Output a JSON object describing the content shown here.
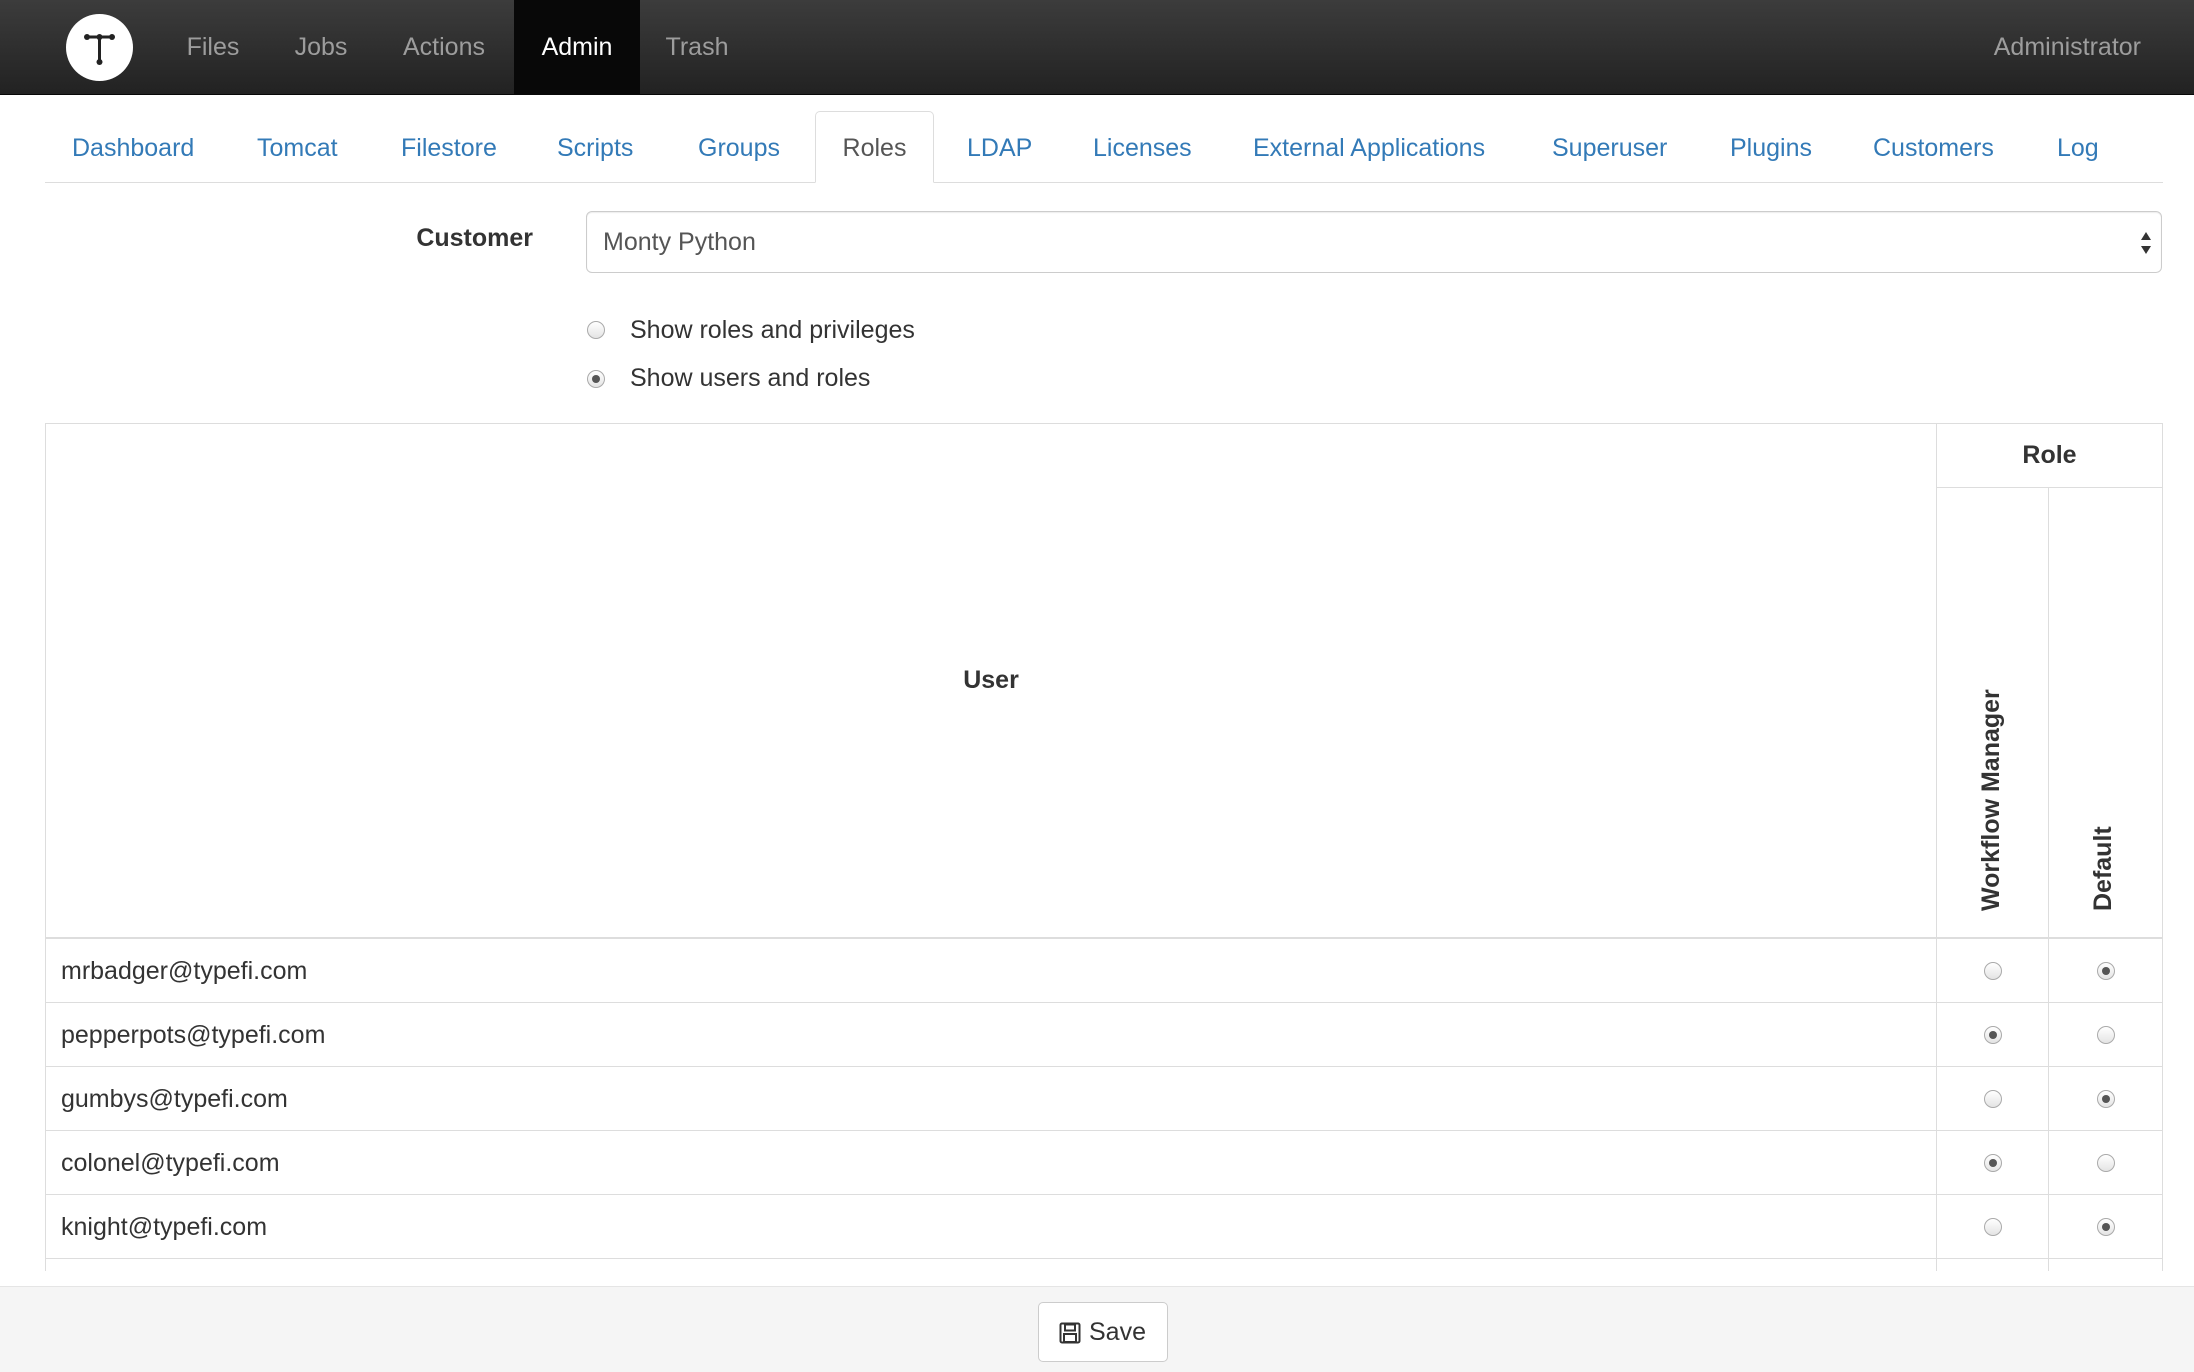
{
  "navbar": {
    "logo_icon": "typefi-t-logo-icon",
    "items": [
      {
        "label": "Files"
      },
      {
        "label": "Jobs"
      },
      {
        "label": "Actions"
      },
      {
        "label": "Admin",
        "active": true
      },
      {
        "label": "Trash"
      }
    ],
    "user": "Administrator"
  },
  "admin_tabs": [
    {
      "label": "Dashboard"
    },
    {
      "label": "Tomcat"
    },
    {
      "label": "Filestore"
    },
    {
      "label": "Scripts"
    },
    {
      "label": "Groups"
    },
    {
      "label": "Roles",
      "active": true
    },
    {
      "label": "LDAP"
    },
    {
      "label": "Licenses"
    },
    {
      "label": "External Applications"
    },
    {
      "label": "Superuser"
    },
    {
      "label": "Plugins"
    },
    {
      "label": "Customers"
    },
    {
      "label": "Log"
    }
  ],
  "customer": {
    "label": "Customer",
    "selected": "Monty Python"
  },
  "view_options": [
    {
      "label": "Show roles and privileges",
      "checked": false
    },
    {
      "label": "Show users and roles",
      "checked": true
    }
  ],
  "table": {
    "user_header": "User",
    "role_header": "Role",
    "role_columns": [
      "Workflow Manager",
      "Default"
    ],
    "rows": [
      {
        "email": "mrbadger@typefi.com",
        "role": "Default"
      },
      {
        "email": "pepperpots@typefi.com",
        "role": "Workflow Manager"
      },
      {
        "email": "gumbys@typefi.com",
        "role": "Default"
      },
      {
        "email": "colonel@typefi.com",
        "role": "Workflow Manager"
      },
      {
        "email": "knight@typefi.com",
        "role": "Default"
      }
    ]
  },
  "footer": {
    "save_label": "Save",
    "save_icon": "floppy-disk-icon"
  },
  "colors": {
    "navbar": "#222222",
    "link": "#337ab7",
    "border": "#dddddd",
    "footer": "#f5f5f5"
  }
}
